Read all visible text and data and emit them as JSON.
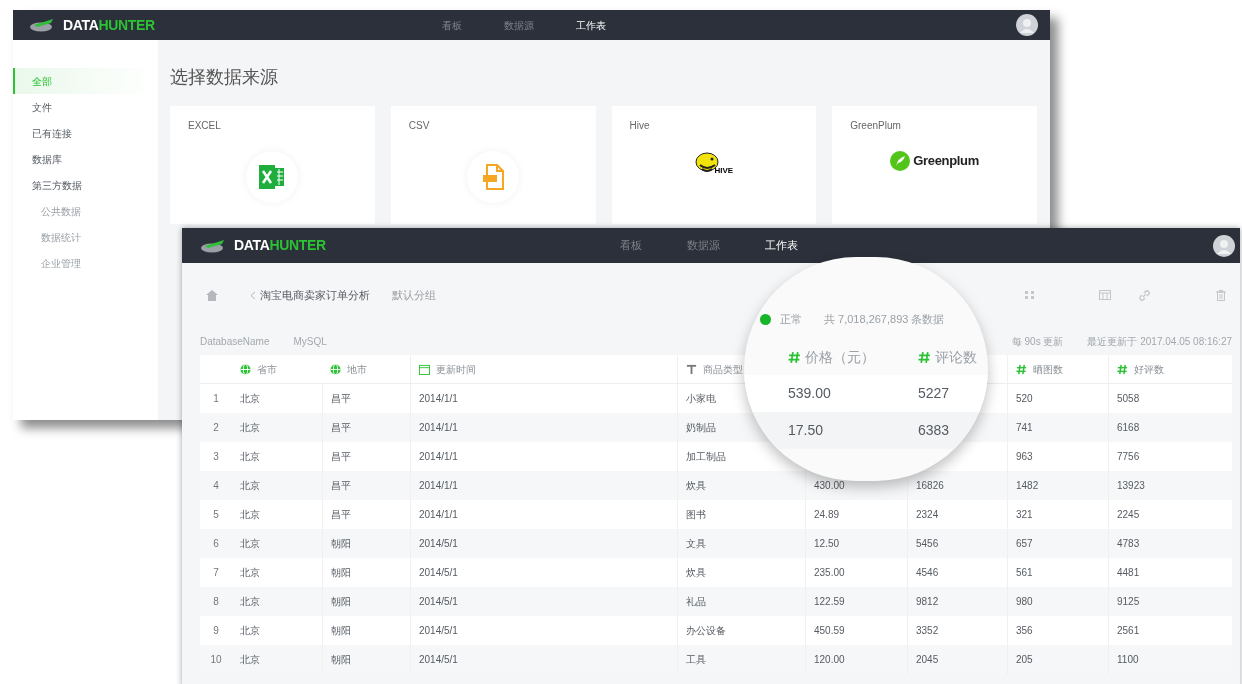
{
  "back_window": {
    "logo": {
      "prefix": "DATA",
      "suffix": "HUNTER"
    },
    "nav": [
      {
        "label": "看板",
        "selected": false
      },
      {
        "label": "数据源",
        "selected": false
      },
      {
        "label": "工作表",
        "selected": true
      }
    ],
    "sidebar": {
      "items": [
        {
          "label": "全部",
          "selected": true
        },
        {
          "label": "文件",
          "selected": false
        },
        {
          "label": "已有连接",
          "selected": false
        },
        {
          "label": "数据库",
          "selected": false
        },
        {
          "label": "第三方数据",
          "selected": false,
          "children": [
            {
              "label": "公共数据",
              "selected": false
            },
            {
              "label": "数据统计",
              "selected": false
            },
            {
              "label": "企业管理",
              "selected": false
            }
          ]
        }
      ]
    },
    "title": "选择数据来源",
    "cards": [
      {
        "label": "EXCEL",
        "kind": "excel"
      },
      {
        "label": "CSV",
        "kind": "csv"
      },
      {
        "label": "Hive",
        "kind": "hive",
        "logo_text": "HIVE"
      },
      {
        "label": "GreenPlum",
        "kind": "greenplum",
        "logo_text": "Greenplum"
      }
    ]
  },
  "front_window": {
    "logo": {
      "prefix": "DATA",
      "suffix": "HUNTER"
    },
    "nav": [
      {
        "label": "看板",
        "selected": false
      },
      {
        "label": "数据源",
        "selected": false
      },
      {
        "label": "工作表",
        "selected": true
      }
    ],
    "breadcrumb": {
      "title": "淘宝电商卖家订单分析",
      "group": "默认分组"
    },
    "source": {
      "database": "DatabaseName",
      "engine": "MySQL"
    },
    "meta": [
      "每 90s 更新",
      "最近更新于 2017.04.05 08:16:27"
    ],
    "table": {
      "columns": [
        {
          "label": "省市",
          "kind": "geo"
        },
        {
          "label": "地市",
          "kind": "geo"
        },
        {
          "label": "更新时间",
          "kind": "date"
        },
        {
          "label": "商品类型",
          "kind": "text"
        },
        null,
        null,
        {
          "label": "晒图数",
          "kind": "number"
        },
        {
          "label": "好评数",
          "kind": "number"
        }
      ],
      "rows": [
        {
          "index": "1",
          "cells": [
            "北京",
            "昌平",
            "2014/1/1",
            "小家电",
            null,
            null,
            "520",
            "5058"
          ]
        },
        {
          "index": "2",
          "cells": [
            "北京",
            "昌平",
            "2014/1/1",
            "奶制品",
            null,
            null,
            "741",
            "6168"
          ]
        },
        {
          "index": "3",
          "cells": [
            "北京",
            "昌平",
            "2014/1/1",
            "加工制品",
            null,
            null,
            "963",
            "7756"
          ]
        },
        {
          "index": "4",
          "cells": [
            "北京",
            "昌平",
            "2014/1/1",
            "炊具",
            "430.00",
            "16826",
            "1482",
            "13923"
          ]
        },
        {
          "index": "5",
          "cells": [
            "北京",
            "昌平",
            "2014/1/1",
            "图书",
            "24.89",
            "2324",
            "321",
            "2245"
          ]
        },
        {
          "index": "6",
          "cells": [
            "北京",
            "朝阳",
            "2014/5/1",
            "文具",
            "12.50",
            "5456",
            "657",
            "4783"
          ]
        },
        {
          "index": "7",
          "cells": [
            "北京",
            "朝阳",
            "2014/5/1",
            "炊具",
            "235.00",
            "4546",
            "561",
            "4481"
          ]
        },
        {
          "index": "8",
          "cells": [
            "北京",
            "朝阳",
            "2014/5/1",
            "礼品",
            "122.59",
            "9812",
            "980",
            "9125"
          ]
        },
        {
          "index": "9",
          "cells": [
            "北京",
            "朝阳",
            "2014/5/1",
            "办公设备",
            "450.59",
            "3352",
            "356",
            "2561"
          ]
        },
        {
          "index": "10",
          "cells": [
            "北京",
            "朝阳",
            "2014/5/1",
            "工具",
            "120.00",
            "2045",
            "205",
            "1100"
          ]
        }
      ]
    }
  },
  "magnifier": {
    "status": {
      "kind": "normal",
      "label": "正常"
    },
    "total": "共 7,018,267,893 条数据",
    "columns": [
      {
        "label": "价格（元）",
        "kind": "number"
      },
      {
        "label": "评论数",
        "kind": "number"
      }
    ],
    "rows": [
      [
        "539.00",
        "5227"
      ],
      [
        "17.50",
        "6383"
      ]
    ]
  }
}
